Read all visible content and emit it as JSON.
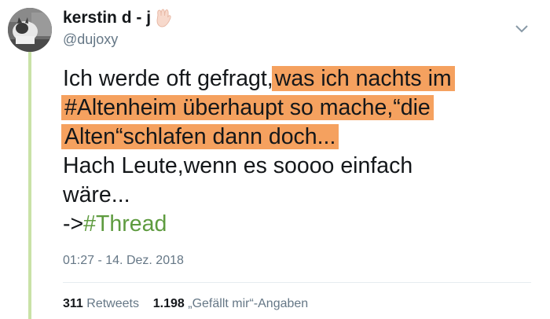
{
  "user": {
    "display_name": "kerstin d - j",
    "handle": "@dujoxy",
    "name_emoji": "vulcan-salute"
  },
  "tweet": {
    "line1_plain": "Ich werde oft gefragt,",
    "line1_hl": "was ich nachts im",
    "line2_hl": "#Altenheim überhaupt so mache,“die",
    "line3_hl": "Alten“schlafen dann doch...",
    "line4": "Hach Leute,wenn es soooo einfach",
    "line5": "wäre...",
    "line6_prefix": "->",
    "line6_hashtag": "#Thread",
    "highlight_color": "#f5a15f",
    "hashtag_color": "#5e9b3f"
  },
  "meta": {
    "timestamp": "01:27 - 14. Dez. 2018"
  },
  "stats": {
    "retweets_count": "311",
    "retweets_label": "Retweets",
    "likes_count": "1.198",
    "likes_label": "„Gefällt mir“-Angaben"
  },
  "icons": {
    "menu": "chevron-down-icon",
    "avatar": "avatar"
  }
}
